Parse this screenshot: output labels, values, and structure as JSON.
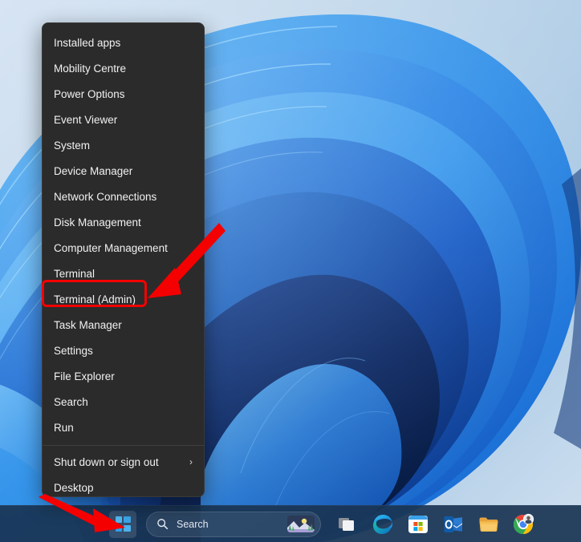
{
  "desktop": {
    "wallpaper_name": "windows-11-bloom-wallpaper",
    "colors": {
      "bg_light": "#cfdff0",
      "ribbon_light": "#4ea8f0",
      "ribbon_mid": "#1f78e0",
      "ribbon_dark": "#0b3f9e",
      "ribbon_deep": "#072a6e"
    }
  },
  "winx_menu": {
    "name": "Win+X power user menu",
    "background": "#2b2b2b",
    "items": [
      {
        "label": "Installed apps",
        "submenu": false
      },
      {
        "label": "Mobility Centre",
        "submenu": false
      },
      {
        "label": "Power Options",
        "submenu": false
      },
      {
        "label": "Event Viewer",
        "submenu": false
      },
      {
        "label": "System",
        "submenu": false
      },
      {
        "label": "Device Manager",
        "submenu": false
      },
      {
        "label": "Network Connections",
        "submenu": false
      },
      {
        "label": "Disk Management",
        "submenu": false
      },
      {
        "label": "Computer Management",
        "submenu": false
      },
      {
        "label": "Terminal",
        "submenu": false
      },
      {
        "label": "Terminal (Admin)",
        "submenu": false
      },
      {
        "label": "Task Manager",
        "submenu": false
      },
      {
        "label": "Settings",
        "submenu": false
      },
      {
        "label": "File Explorer",
        "submenu": false
      },
      {
        "label": "Search",
        "submenu": false
      },
      {
        "label": "Run",
        "submenu": false
      },
      {
        "label": "Shut down or sign out",
        "submenu": true,
        "chevron": "›"
      },
      {
        "label": "Desktop",
        "submenu": false
      }
    ],
    "separator_before_index": 16
  },
  "annotations": {
    "highlight_color": "#f40000",
    "highlight_target": "Terminal (Admin)",
    "arrows": [
      {
        "name": "arrow-to-terminal-admin",
        "points_to": "Terminal (Admin)"
      },
      {
        "name": "arrow-to-start-button",
        "points_to": "Start button"
      }
    ]
  },
  "taskbar": {
    "background": "#193452",
    "start_button": {
      "label": "Start",
      "icon": "windows-logo-icon",
      "active": true
    },
    "search": {
      "placeholder": "Search",
      "icon": "search-icon",
      "thumbnail": "daily-image-thumbnail"
    },
    "apps": [
      {
        "name": "task-view",
        "label": "Task View"
      },
      {
        "name": "microsoft-edge",
        "label": "Microsoft Edge"
      },
      {
        "name": "microsoft-store",
        "label": "Microsoft Store"
      },
      {
        "name": "outlook",
        "label": "Outlook"
      },
      {
        "name": "file-explorer",
        "label": "File Explorer"
      },
      {
        "name": "google-chrome",
        "label": "Google Chrome"
      }
    ]
  }
}
